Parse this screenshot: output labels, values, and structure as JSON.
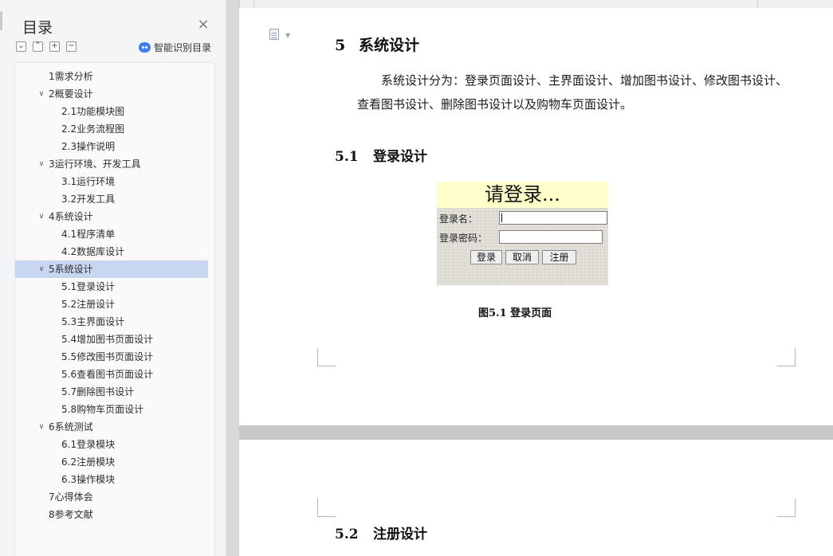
{
  "toc": {
    "title": "目录",
    "close_icon": "close-icon",
    "tools": [
      "collapse-all-icon",
      "collapse-level-icon",
      "expand-level-icon",
      "remove-level-icon"
    ],
    "smart_label": "智能识别目录",
    "items": [
      {
        "label": "1需求分析",
        "level": 1,
        "has_children": false,
        "active": false
      },
      {
        "label": "2概要设计",
        "level": 1,
        "has_children": true,
        "active": false
      },
      {
        "label": "2.1功能模块图",
        "level": 2,
        "has_children": false,
        "active": false
      },
      {
        "label": "2.2业务流程图",
        "level": 2,
        "has_children": false,
        "active": false
      },
      {
        "label": "2.3操作说明",
        "level": 2,
        "has_children": false,
        "active": false
      },
      {
        "label": "3运行环境、开发工具",
        "level": 1,
        "has_children": true,
        "active": false
      },
      {
        "label": "3.1运行环境",
        "level": 2,
        "has_children": false,
        "active": false
      },
      {
        "label": "3.2开发工具",
        "level": 2,
        "has_children": false,
        "active": false
      },
      {
        "label": "4系统设计",
        "level": 1,
        "has_children": true,
        "active": false
      },
      {
        "label": "4.1程序清单",
        "level": 2,
        "has_children": false,
        "active": false
      },
      {
        "label": "4.2数据库设计",
        "level": 2,
        "has_children": false,
        "active": false
      },
      {
        "label": "5系统设计",
        "level": 1,
        "has_children": true,
        "active": true
      },
      {
        "label": "5.1登录设计",
        "level": 2,
        "has_children": false,
        "active": false
      },
      {
        "label": "5.2注册设计",
        "level": 2,
        "has_children": false,
        "active": false
      },
      {
        "label": "5.3主界面设计",
        "level": 2,
        "has_children": false,
        "active": false
      },
      {
        "label": "5.4增加图书页面设计",
        "level": 2,
        "has_children": false,
        "active": false
      },
      {
        "label": "5.5修改图书页面设计",
        "level": 2,
        "has_children": false,
        "active": false
      },
      {
        "label": "5.6查看图书页面设计",
        "level": 2,
        "has_children": false,
        "active": false
      },
      {
        "label": "5.7删除图书设计",
        "level": 2,
        "has_children": false,
        "active": false
      },
      {
        "label": "5.8购物车页面设计",
        "level": 2,
        "has_children": false,
        "active": false
      },
      {
        "label": "6系统测试",
        "level": 1,
        "has_children": true,
        "active": false
      },
      {
        "label": "6.1登录模块",
        "level": 2,
        "has_children": false,
        "active": false
      },
      {
        "label": "6.2注册模块",
        "level": 2,
        "has_children": false,
        "active": false
      },
      {
        "label": "6.3操作模块",
        "level": 2,
        "has_children": false,
        "active": false
      },
      {
        "label": "7心得体会",
        "level": 1,
        "has_children": false,
        "active": false
      },
      {
        "label": "8参考文献",
        "level": 1,
        "has_children": false,
        "active": false
      }
    ]
  },
  "document": {
    "heading1": {
      "num": "5",
      "text": "系统设计"
    },
    "paragraph": "系统设计分为：登录页面设计、主界面设计、增加图书设计、修改图书设计、查看图书设计、删除图书设计以及购物车页面设计。",
    "heading2": {
      "num": "5.1",
      "text": "登录设计"
    },
    "figure": {
      "header": "请登录...",
      "username_label": "登录名：",
      "password_label": "登录密码：",
      "buttons": [
        "登录",
        "取消",
        "注册"
      ]
    },
    "figure_caption": "图5.1 登录页面",
    "next_heading": {
      "num": "5.2",
      "text": "注册设计"
    }
  },
  "colors": {
    "active_item": "#c8d6f2",
    "figure_header_bg": "#ffffcc",
    "smart_icon": "#3d7ef0"
  }
}
